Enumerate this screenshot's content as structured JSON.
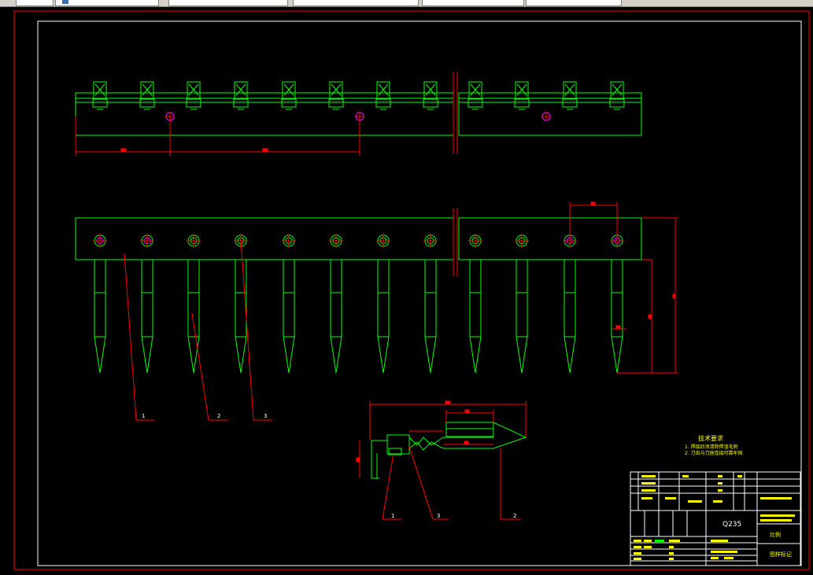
{
  "toolbar": {
    "fields": [
      {
        "name": "layer-field",
        "label": ""
      },
      {
        "name": "color-field",
        "label": ""
      },
      {
        "name": "linetype-field",
        "label": ""
      },
      {
        "name": "lineweight-field",
        "label": ""
      },
      {
        "name": "plotstyle-field",
        "label": ""
      }
    ]
  },
  "drawing": {
    "part_labels": [
      "1",
      "2",
      "3"
    ],
    "detail_labels": [
      "1",
      "3",
      "2"
    ],
    "notes": {
      "title": "技术要求",
      "lines": [
        "1. 焊接后须清除焊渣毛刺",
        "2. 刀齿与刀座连接可靠牢固"
      ]
    },
    "title_block": {
      "material": "Q235",
      "part_name": "切割器总装配图",
      "sub_name": "(收割机)",
      "scale": "1:1",
      "label_right_1": "比例",
      "label_right_2": "图样标记"
    }
  },
  "colors": {
    "green": "#00ff00",
    "red": "#ff0000",
    "yellow": "#ffff00",
    "white": "#ffffff",
    "magenta": "#ff00ff"
  }
}
